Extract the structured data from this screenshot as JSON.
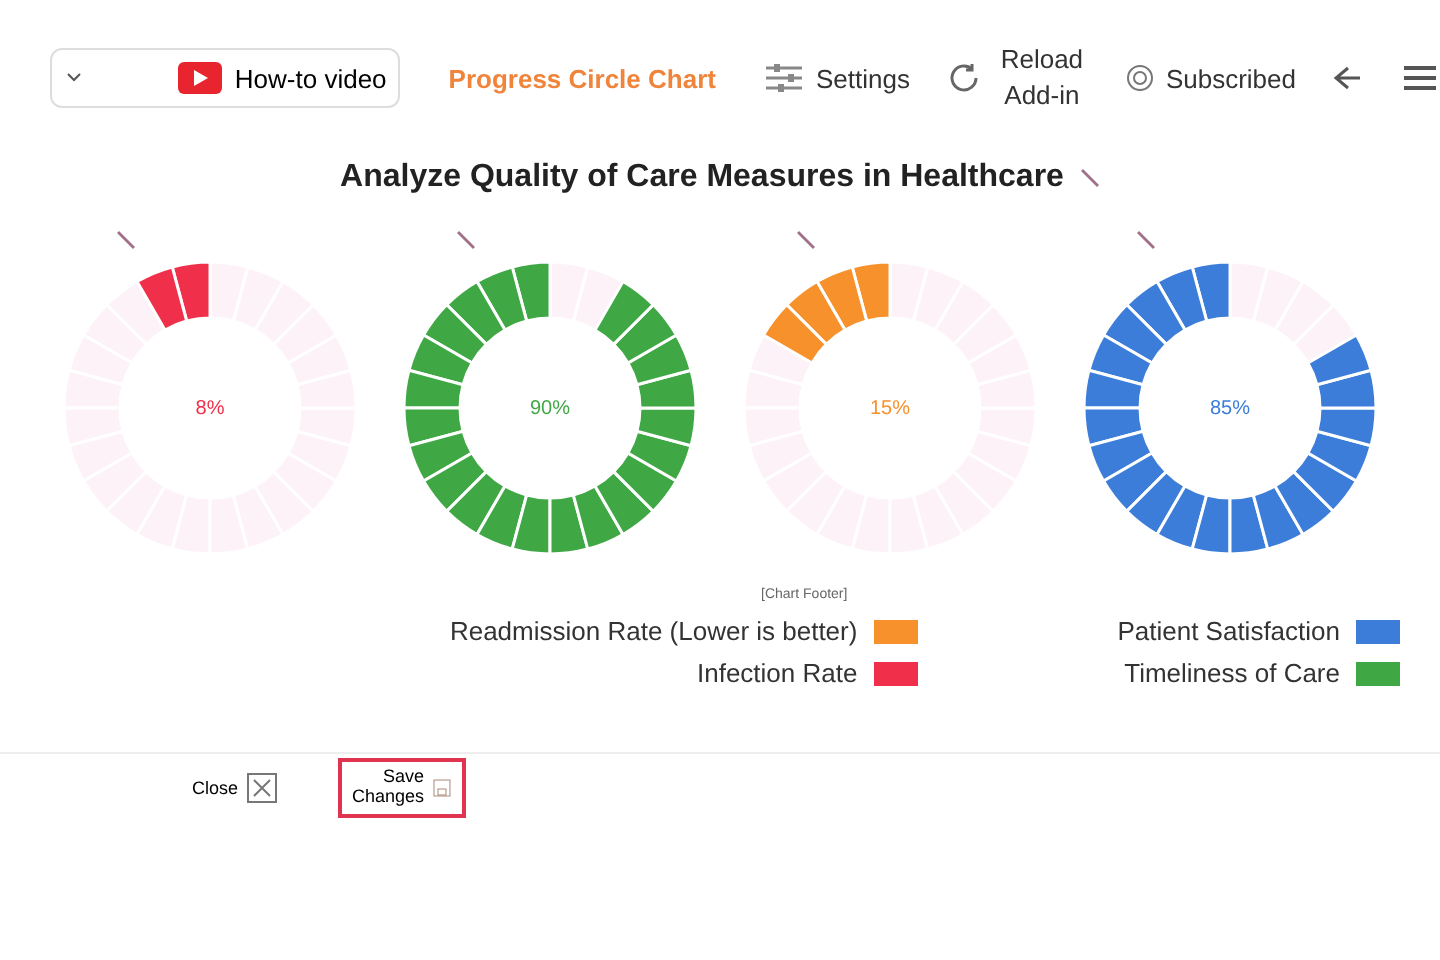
{
  "toolbar": {
    "subscribed": "Subscribed",
    "reload": "Reload Add-in",
    "settings": "Settings",
    "app_title": "Progress Circle Chart",
    "video": "How-to video"
  },
  "title": "Analyze Quality of Care Measures in Healthcare",
  "charts": [
    {
      "reading": "8%",
      "color": "#f0304a"
    },
    {
      "reading": "90%",
      "color": "#3fa845"
    },
    {
      "reading": "15%",
      "color": "#f7912c"
    },
    {
      "reading": "85%",
      "color": "#3b7dd8"
    }
  ],
  "footer_note": "[Chart Footer]",
  "legend": [
    {
      "label": "Readmission Rate (Lower is better)",
      "color": "#f7912c"
    },
    {
      "label": "Infection Rate",
      "color": "#f0304a"
    },
    {
      "label": "Patient Satisfaction",
      "color": "#3b7dd8"
    },
    {
      "label": "Timeliness of Care",
      "color": "#3fa845"
    }
  ],
  "buttons": {
    "save": "Save Changes",
    "close": "Close"
  }
}
